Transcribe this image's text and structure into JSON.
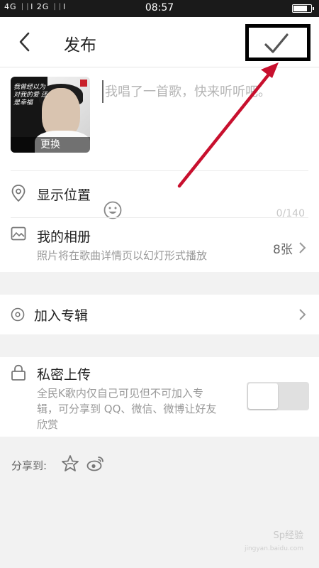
{
  "statusbar": {
    "signal": "4G ᛁᛁl 2G ᛁᛁl",
    "time": "08:57",
    "battery_level": 0.85
  },
  "header": {
    "title": "发布",
    "back_icon": "chevron-left-icon",
    "confirm_icon": "check-icon"
  },
  "song": {
    "cover_text": "我曾经以为对我的爱 还是幸福",
    "change_label": "更换",
    "caption_placeholder": "我唱了一首歌，快来听听吧。",
    "caption_value": "",
    "char_count": "0/140"
  },
  "location": {
    "label": "显示位置",
    "icon": "location-pin-icon"
  },
  "album": {
    "title": "我的相册",
    "subtitle": "照片将在歌曲详情页以幻灯形式播放",
    "count": "8张",
    "icon": "image-icon"
  },
  "special_album": {
    "label": "加入专辑",
    "icon": "disc-icon"
  },
  "private": {
    "title": "私密上传",
    "description_lines": [
      "全民K歌内仅自己可见但不可加入专",
      "辑，可分享到 QQ、微信、微博让好友",
      "欣赏"
    ],
    "enabled": false,
    "icon": "lock-icon"
  },
  "share": {
    "label": "分享到:",
    "targets": [
      "qzone-icon",
      "weibo-icon"
    ]
  },
  "watermark": {
    "text": "Sp经验",
    "url": "jingyan.baidu.com"
  },
  "annotation": {
    "arrow_color": "#c8102e",
    "box_color": "#000000"
  }
}
